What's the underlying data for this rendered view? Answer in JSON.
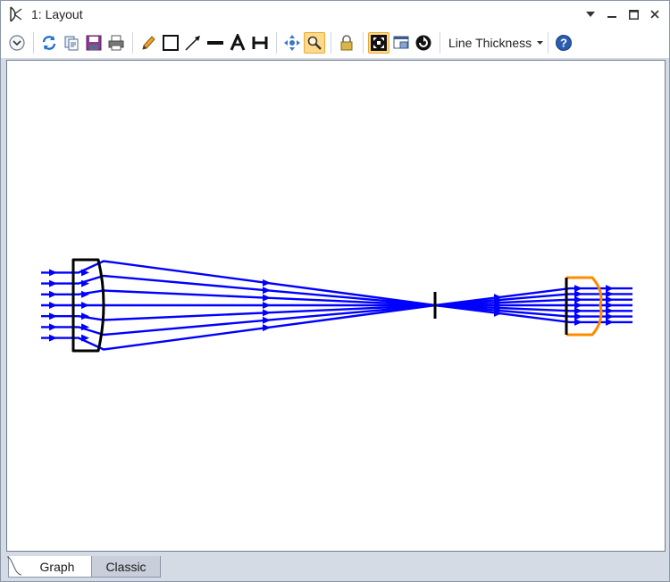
{
  "window": {
    "title": "1: Layout",
    "controls": [
      "menu-dropdown",
      "minimize",
      "maximize",
      "close"
    ]
  },
  "toolbar": {
    "line_thickness_label": "Line Thickness",
    "icons": [
      "settings-expand-icon",
      "refresh-icon",
      "copy-icon",
      "save-icon",
      "print-icon",
      "pencil-icon",
      "rectangle-icon",
      "arrow-icon",
      "line-icon",
      "text-icon",
      "dimension-icon",
      "pan-icon",
      "zoom-icon",
      "lock-icon",
      "fit-icon",
      "window-icon",
      "rotate-icon",
      "help-icon"
    ],
    "active": [
      "zoom-icon",
      "fit-icon"
    ]
  },
  "layout": {
    "ray_color": "#0000ff",
    "lens_color": "#000000",
    "selected_lens_color": "#ff8c00"
  },
  "tabs": {
    "graph": "Graph",
    "classic": "Classic",
    "active": "Graph"
  }
}
